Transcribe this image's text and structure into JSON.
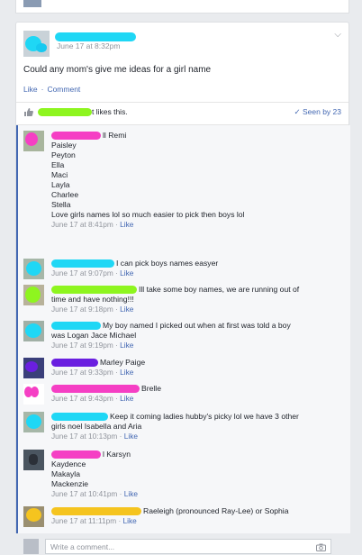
{
  "post": {
    "timestamp": "June 17 at 8:32pm",
    "chevron": "⌵",
    "text": "Could any mom's give me ideas for a girl name",
    "actions": {
      "like": "Like",
      "separator": "·",
      "comment": "Comment"
    },
    "likes_suffix": "t likes this.",
    "seen": "Seen by 23"
  },
  "comments": [
    {
      "name_suffix": "ll Remi",
      "lines": [
        "Paisley",
        "Peyton",
        "Ella",
        "Maci",
        "Layla",
        "Charlee",
        "Stella",
        "Love girls names lol so much easier to pick then boys lol"
      ],
      "time": "June 17 at 8:41pm"
    },
    {
      "name_suffix": "",
      "lines": [
        "I can pick boys names easyer"
      ],
      "time": "June 17 at 9:07pm"
    },
    {
      "name_suffix": "",
      "lines": [
        "Ill take some boy names, we are running out of",
        "time and have nothing!!!"
      ],
      "time": "June 17 at 9:18pm"
    },
    {
      "name_suffix": "",
      "lines": [
        "My boy named I picked out when at first was told a boy",
        "was Logan Jace Michael"
      ],
      "time": "June 17 at 9:19pm"
    },
    {
      "name_suffix": "",
      "lines": [
        "Marley Paige"
      ],
      "time": "June 17 at 9:33pm"
    },
    {
      "name_suffix": "",
      "lines": [
        "Brelle"
      ],
      "time": "June 17 at 9:43pm"
    },
    {
      "name_suffix": "",
      "lines": [
        "Keep it coming ladies hubby's picky lol we have 3 other",
        "girls noel Isabella and Aria"
      ],
      "time": "June 17 at 10:13pm"
    },
    {
      "name_suffix": "l Karsyn",
      "lines": [
        "Kaydence",
        "Makayla",
        "Mackenzie"
      ],
      "time": "June 17 at 10:41pm"
    },
    {
      "name_suffix": "",
      "lines": [
        "Raeleigh (pronounced Ray-Lee) or Sophia"
      ],
      "time": "June 17 at 11:11pm"
    }
  ],
  "meta": {
    "like": "Like",
    "separator": "·"
  },
  "write_placeholder": "Write a comment...",
  "colors": {
    "link": "#4267b2",
    "meta": "#90949c",
    "redact_cyan": "#1fd7f5",
    "redact_green": "#8ef51f",
    "redact_pink": "#f53fc4",
    "redact_purple": "#6a1fe0",
    "redact_yellow": "#f5c41f"
  },
  "icons": [
    "chevron-down-icon",
    "thumbs-up-icon",
    "check-icon",
    "camera-icon"
  ]
}
